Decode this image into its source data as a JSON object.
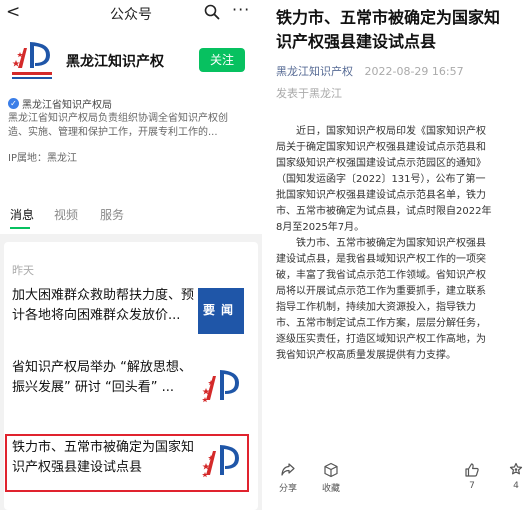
{
  "left": {
    "topbar": {
      "back_glyph": "<",
      "title": "公众号",
      "search_icon": "search-icon",
      "more_glyph": "···"
    },
    "account": {
      "name": "黑龙江知识产权",
      "follow_label": "关注",
      "verified_by": "黑龙江省知识产权局",
      "description_lines": [
        "黑龙江省知识产权局负责组织协调全省知识产权创",
        "造、实施、管理和保护工作，开展专利工作的..."
      ],
      "ip_location": "IP属地：黑龙江"
    },
    "tabs": [
      {
        "label": "消息",
        "active": true
      },
      {
        "label": "视频",
        "active": false
      },
      {
        "label": "服务",
        "active": false
      }
    ],
    "day_label": "昨天",
    "articles": [
      {
        "title_lines": [
          "加大困难群众救助帮扶力度、预",
          "计各地将向困难群众发放价..."
        ],
        "thumb_text": "要闻"
      },
      {
        "title_lines": [
          "省知识产权局举办 “解放思想、",
          "振兴发展” 研讨 “回头看” ..."
        ],
        "thumb_text": ""
      },
      {
        "title_lines": [
          "铁力市、五常市被确定为国家知",
          "识产权强县建设试点县"
        ],
        "thumb_text": "",
        "highlighted": true
      }
    ]
  },
  "right": {
    "title_lines": [
      "铁力市、五常市被确定为国家知",
      "识产权强县建设试点县"
    ],
    "source": "黑龙江知识产权",
    "date": "2022-08-29 16:57",
    "location": "发表于黑龙江",
    "body_lines": [
      "　　近日，国家知识产权局印发《国家知识产权",
      "局关于确定国家知识产权强县建设试点示范县和",
      "国家级知识产权强国建设试点示范园区的通知》",
      "（国知发运函字〔2022〕131号），公布了第一",
      "批国家知识产权强县建设试点示范县名单，铁力",
      "市、五常市被确定为试点县，试点时限自2022年",
      "8月至2025年7月。",
      "　　铁力市、五常市被确定为国家知识产权强县",
      "建设试点县，是我省县域知识产权工作的一项突",
      "破，丰富了我省试点示范工作领域。省知识产权",
      "局将以开展试点示范工作为重要抓手，建立联系",
      "指导工作机制，持续加大资源投入，指导铁力",
      "市、五常市制定试点工作方案，层层分解任务，",
      "逐级压实责任，打造区域知识产权工作高地，为",
      "我省知识产权高质量发展提供有力支撑。"
    ],
    "actions": [
      {
        "label": "分享",
        "icon": "share-icon"
      },
      {
        "label": "收藏",
        "icon": "favorite-icon"
      },
      {
        "label": "7",
        "icon": "thumbs-up-icon"
      },
      {
        "label": "4",
        "icon": "appreciate-icon"
      }
    ]
  },
  "colors": {
    "accent_green": "#07c160",
    "link_blue": "#576b95",
    "highlight_red": "#e0232e",
    "logo_red": "#d42a2a",
    "logo_blue": "#1f56a8"
  }
}
